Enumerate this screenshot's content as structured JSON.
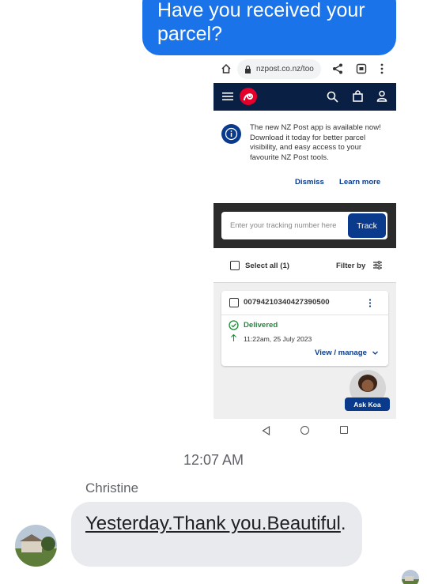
{
  "sent_message": {
    "text": "Have you received your parcel?",
    "color": "#1a73e8"
  },
  "screenshot": {
    "browser": {
      "url": "nzpost.co.nz/too"
    },
    "banner": {
      "text": "The new NZ Post app is available now! Download it today for better parcel visibility, and easy access to your favourite NZ Post tools.",
      "dismiss": "Dismiss",
      "learn_more": "Learn more"
    },
    "tracking": {
      "placeholder": "Enter your tracking number here",
      "button": "Track"
    },
    "list": {
      "select_all": "Select all (1)",
      "filter": "Filter by"
    },
    "parcel": {
      "number": "00794210340427390500",
      "status": "Delivered",
      "date": "11:22am, 25 July 2023",
      "view_manage": "View / manage"
    },
    "ask_koa": "Ask Koa",
    "brand_colors": {
      "navy": "#0a1f44",
      "blue": "#0a3a8c",
      "red": "#e4002b",
      "green": "#1f8a3a"
    }
  },
  "timestamp": "12:07 AM",
  "sender": "Christine",
  "received_message": {
    "link_text": "Yesterday.Thank you.Beautiful",
    "trailing": "."
  }
}
